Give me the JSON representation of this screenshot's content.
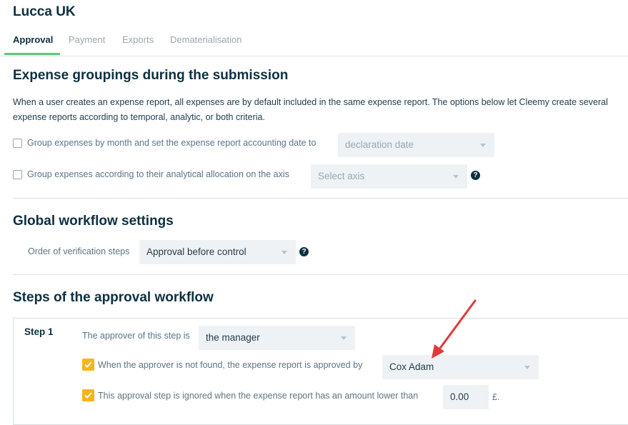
{
  "page": {
    "title": "Lucca UK"
  },
  "tabs": [
    {
      "label": "Approval",
      "active": true
    },
    {
      "label": "Payment",
      "active": false
    },
    {
      "label": "Exports",
      "active": false
    },
    {
      "label": "Dematerialisation",
      "active": false
    }
  ],
  "grouping": {
    "heading": "Expense groupings during the submission",
    "description": "When a user creates an expense report, all expenses are by default included in the same expense report. The options below let Cleemy create several expense reports according to temporal, analytic, or both criteria.",
    "by_month": {
      "label": "Group expenses by month and set the expense report accounting date to",
      "checked": false,
      "select_value": "declaration date"
    },
    "by_axis": {
      "label": "Group expenses according to their analytical allocation on the axis",
      "checked": false,
      "select_placeholder": "Select axis"
    }
  },
  "global": {
    "heading": "Global workflow settings",
    "order_label": "Order of verification steps",
    "order_value": "Approval before control"
  },
  "steps": {
    "heading": "Steps of the approval workflow",
    "step1": {
      "label": "Step 1",
      "approver_label": "The approver of this step is",
      "approver_value": "the manager",
      "not_found_label": "When the approver is not found, the expense report is approved by",
      "not_found_checked": true,
      "not_found_value": "Cox Adam",
      "ignored_label": "This approval step is ignored when the expense report has an amount lower than",
      "ignored_checked": true,
      "amount": "0.00",
      "currency": "£."
    }
  },
  "help_glyph": "?",
  "colors": {
    "accent": "#5cc97b",
    "checkbox": "#f4b41a",
    "annotation_arrow": "#e03a3a",
    "heading": "#0d3042"
  }
}
